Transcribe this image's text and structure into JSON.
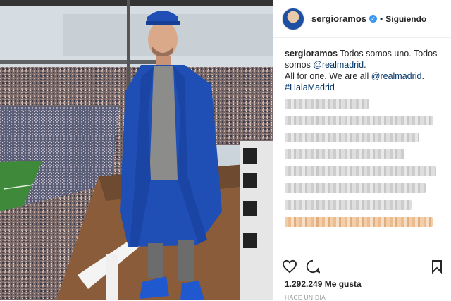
{
  "post": {
    "username": "sergioramos",
    "verified_icon": "verified-badge-icon",
    "separator": "•",
    "follow_status": "Siguiendo",
    "caption_line1": "Todos somos uno. Todos somos",
    "caption_mention1": "@realmadrid",
    "caption_end1": ".",
    "caption_line2": "All for one. We are all",
    "caption_mention2": "@realmadrid",
    "caption_end2": ".",
    "hashtag": "#HalaMadrid",
    "likes": "1.292.249 Me gusta",
    "time": "HACE UN DÍA"
  },
  "icons": {
    "like": "heart-icon",
    "comment": "comment-icon",
    "save": "bookmark-icon"
  },
  "colors": {
    "link": "#003569",
    "coat": "#1f4fb5",
    "verified": "#3897f0"
  }
}
